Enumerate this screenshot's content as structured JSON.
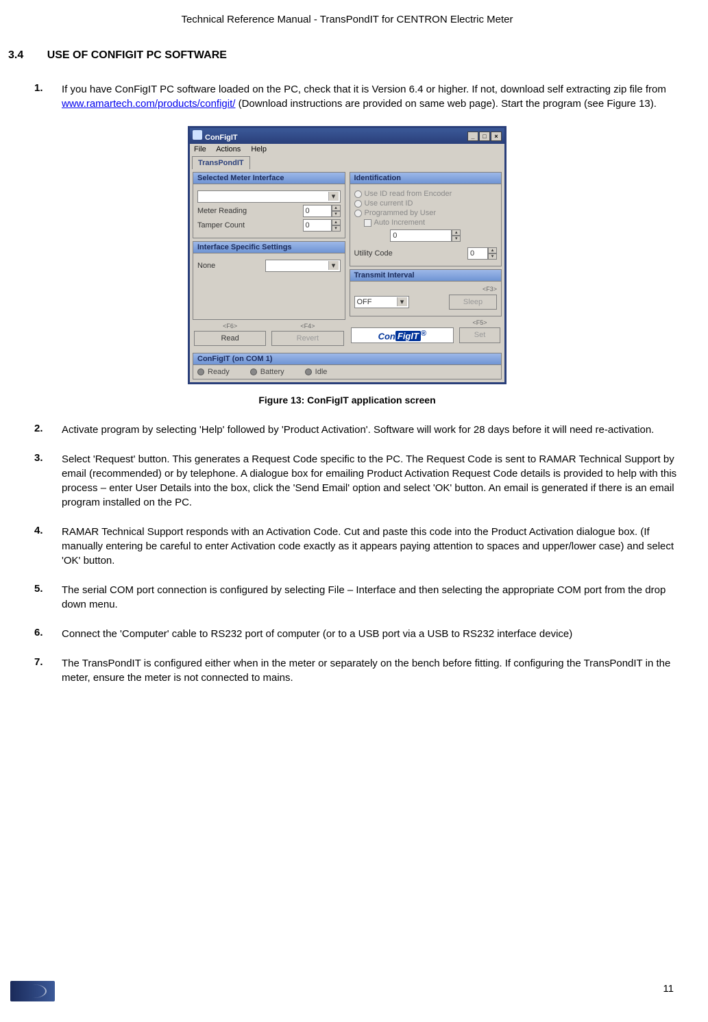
{
  "header": "Technical Reference Manual - TransPondIT for CENTRON Electric Meter",
  "section": {
    "number": "3.4",
    "title": "USE OF CONFIGIT PC SOFTWARE"
  },
  "steps": [
    {
      "num": "1.",
      "before_link": "If you have ConFigIT PC software loaded on the PC, check that it is Version 6.4 or higher. If not, download self extracting zip file from ",
      "link": "www.ramartech.com/products/configit/",
      "after_link": " (Download instructions are provided on same web page). Start the program (see Figure 13)."
    },
    {
      "num": "2.",
      "text": "Activate program by selecting 'Help' followed by 'Product Activation'. Software will work for 28 days before it will need re-activation."
    },
    {
      "num": "3.",
      "text": "Select 'Request' button. This generates a Request Code specific to the PC. The Request Code is sent to RAMAR Technical Support by email (recommended) or by telephone. A dialogue box for emailing Product Activation Request Code details is provided to help with this process – enter User Details into the box, click the 'Send Email' option and select 'OK' button. An email is generated if there is an email program installed on the PC."
    },
    {
      "num": "4.",
      "text": "RAMAR Technical Support responds with an Activation Code. Cut and paste this code into the Product Activation dialogue box. (If manually entering be careful to enter Activation code exactly as it appears paying attention to spaces and upper/lower case) and select 'OK' button."
    },
    {
      "num": "5.",
      "text": "The serial COM port connection is configured by selecting File – Interface and then selecting the appropriate COM port from the drop down menu."
    },
    {
      "num": "6.",
      "text": "Connect the 'Computer' cable to RS232 port of computer (or to a USB port via a USB to RS232 interface device)"
    },
    {
      "num": "7.",
      "text": "The TransPondIT is configured either when in the meter or separately on the bench before fitting. If configuring the TransPondIT in the meter, ensure the meter is not connected to mains."
    }
  ],
  "figure_caption": "Figure 13: ConFigIT application screen",
  "page_number": "11",
  "app": {
    "title": "ConFigIT",
    "menu": [
      "File",
      "Actions",
      "Help"
    ],
    "tab": "TransPondIT",
    "left": {
      "panel1": {
        "title": "Selected Meter Interface",
        "meter_reading_label": "Meter Reading",
        "meter_reading_value": "0",
        "tamper_count_label": "Tamper Count",
        "tamper_count_value": "0"
      },
      "panel2": {
        "title": "Interface Specific Settings",
        "none_label": "None"
      },
      "buttons": {
        "read_fkey": "<F6>",
        "read": "Read",
        "revert_fkey": "<F4>",
        "revert": "Revert"
      }
    },
    "right": {
      "panel1": {
        "title": "Identification",
        "radio1": "Use ID read from Encoder",
        "radio2": "Use current ID",
        "radio3": "Programmed by User",
        "check1": "Auto Increment",
        "id_value": "0",
        "utility_label": "Utility Code",
        "utility_value": "0"
      },
      "panel2": {
        "title": "Transmit Interval",
        "fkey": "<F3>",
        "select_value": "OFF",
        "sleep": "Sleep"
      },
      "buttons": {
        "logo_con": "Con",
        "logo_fig": "FigIT",
        "logo_r": "®",
        "set_fkey": "<F5>",
        "set": "Set"
      }
    },
    "bottom": {
      "title": "ConFigIT (on COM 1)",
      "ready": "Ready",
      "battery": "Battery",
      "idle": "Idle"
    }
  }
}
